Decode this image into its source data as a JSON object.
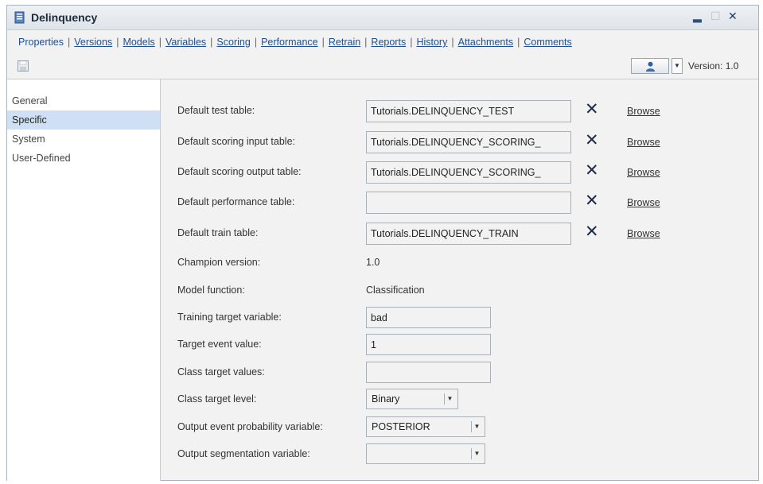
{
  "window": {
    "title": "Delinquency",
    "controls": [
      "minimize",
      "maximize",
      "close"
    ]
  },
  "tabs": [
    {
      "label": "Properties",
      "active": true
    },
    {
      "label": "Versions"
    },
    {
      "label": "Models"
    },
    {
      "label": "Variables"
    },
    {
      "label": "Scoring"
    },
    {
      "label": "Performance"
    },
    {
      "label": "Retrain"
    },
    {
      "label": "Reports"
    },
    {
      "label": "History"
    },
    {
      "label": "Attachments"
    },
    {
      "label": "Comments"
    }
  ],
  "toolbar": {
    "save_icon": "save-icon",
    "version_label": "Version:  1.0"
  },
  "sidebar": {
    "items": [
      {
        "label": "General"
      },
      {
        "label": "Specific",
        "active": true
      },
      {
        "label": "System"
      },
      {
        "label": "User-Defined"
      }
    ]
  },
  "form": {
    "browse_label": "Browse",
    "default_test_table": {
      "label": "Default test table:",
      "value": "Tutorials.DELINQUENCY_TEST"
    },
    "default_scoring_input": {
      "label": "Default scoring input table:",
      "value": "Tutorials.DELINQUENCY_SCORING_"
    },
    "default_scoring_output": {
      "label": "Default scoring output table:",
      "value": "Tutorials.DELINQUENCY_SCORING_"
    },
    "default_performance": {
      "label": "Default performance table:",
      "value": ""
    },
    "default_train": {
      "label": "Default train table:",
      "value": "Tutorials.DELINQUENCY_TRAIN"
    },
    "champion_version": {
      "label": "Champion version:",
      "value": "1.0"
    },
    "model_function": {
      "label": "Model function:",
      "value": "Classification"
    },
    "training_target": {
      "label": "Training target variable:",
      "value": "bad"
    },
    "target_event": {
      "label": "Target event value:",
      "value": "1"
    },
    "class_target_values": {
      "label": "Class target values:",
      "value": ""
    },
    "class_target_level": {
      "label": "Class target level:",
      "value": "Binary"
    },
    "output_event_prob": {
      "label": "Output event probability variable:",
      "value": "POSTERIOR"
    },
    "output_segmentation": {
      "label": "Output segmentation variable:",
      "value": ""
    }
  }
}
